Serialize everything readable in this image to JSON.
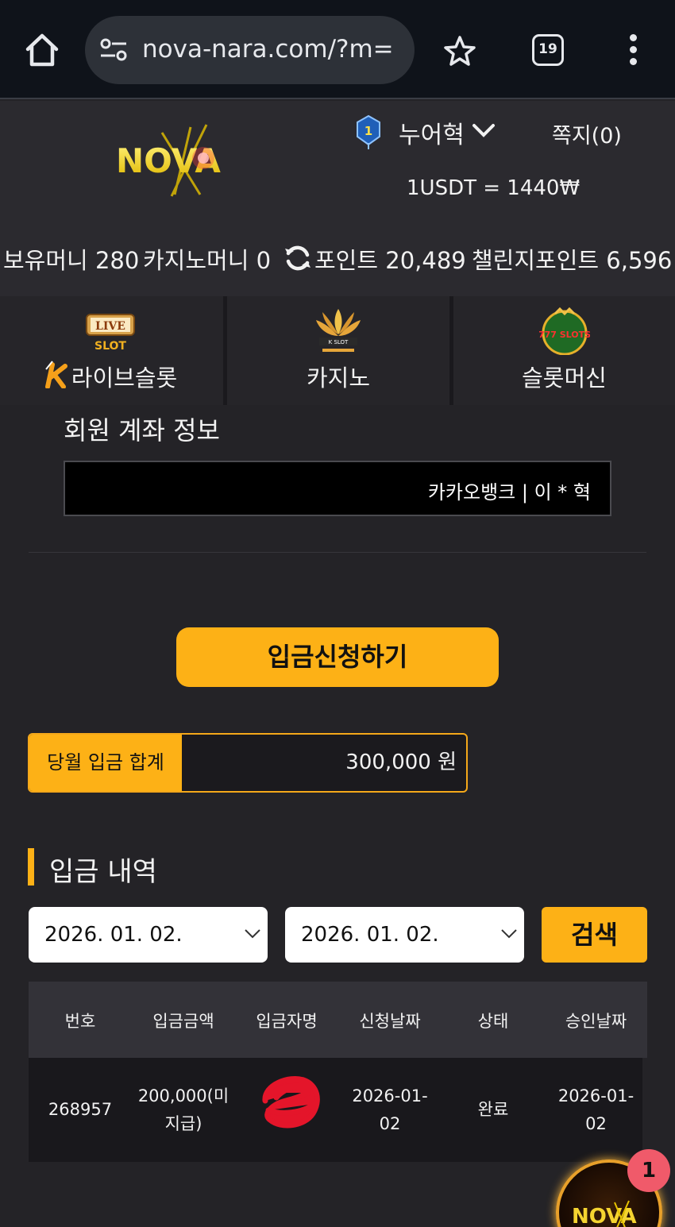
{
  "browser": {
    "url": "nova-nara.com/?m=",
    "tab_count": "19",
    "icons": [
      "home-icon",
      "tune-icon",
      "star-icon",
      "tabs-icon",
      "more-vert-icon"
    ]
  },
  "header": {
    "logo_text": "NOVA",
    "rank": "1",
    "username": "누어혁",
    "messages": "쪽지(0)",
    "rate": "1USDT = 1440₩"
  },
  "balances": {
    "money": "보유머니 280",
    "casino_money": "카지노머니 0",
    "point": "포인트 20,489",
    "challenge_point": "챌린지포인트 6,596"
  },
  "categories": [
    {
      "label": "라이브슬롯",
      "icon": "live-slot-icon",
      "badge_top": "LIVE",
      "badge_bottom": "SLOT"
    },
    {
      "label": "카지노",
      "icon": "casino-lotus-icon",
      "badge": "K SLOT"
    },
    {
      "label": "슬롯머신",
      "icon": "slots-777-icon",
      "badge": "777 SLOTS"
    }
  ],
  "account": {
    "title": "회원 계좌 정보",
    "value": "카카오뱅크 | 이 * 혁"
  },
  "deposit_button": "입금신청하기",
  "monthly": {
    "label": "당월 입금 합계",
    "value": "300,000 원"
  },
  "history": {
    "title": "입금 내역",
    "date_from": "2026. 01. 02.",
    "date_to": "2026. 01. 02.",
    "search_label": "검색",
    "columns": [
      "번호",
      "입금금액",
      "입금자명",
      "신청날짜",
      "상태",
      "승인날짜"
    ],
    "rows": [
      {
        "no": "268957",
        "amount_line1": "200,000(미",
        "amount_line2": "지급)",
        "name": "",
        "req_line1": "2026-01-",
        "req_line2": "02",
        "status": "완료",
        "appr_line1": "2026-01-",
        "appr_line2": "02"
      }
    ]
  },
  "floating_chat": {
    "badge": "1",
    "logo_text": "NOVA"
  },
  "colors": {
    "accent": "#fdb116",
    "background": "#242327",
    "header": "#2b2a2f",
    "badge": "#f05a6a"
  }
}
